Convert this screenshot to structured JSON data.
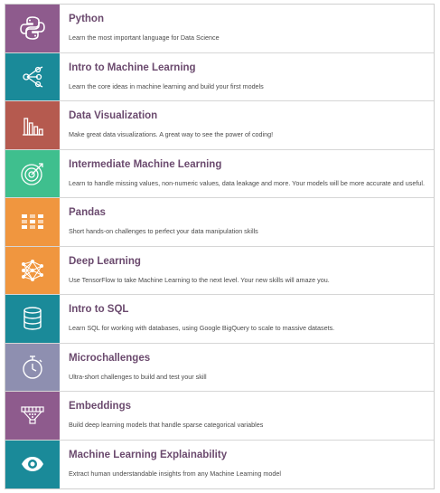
{
  "courses": [
    {
      "title": "Python",
      "description": "Learn the most important language for Data Science",
      "color": "#8e5b8d",
      "icon": "python-logo-icon"
    },
    {
      "title": "Intro to Machine Learning",
      "description": "Learn the core ideas in machine learning and build your first models",
      "color": "#1a8a99",
      "icon": "network-nodes-icon"
    },
    {
      "title": "Data Visualization",
      "description": "Make great data visualizations. A great way to see the power of coding!",
      "color": "#b55a4f",
      "icon": "bar-chart-icon"
    },
    {
      "title": "Intermediate Machine Learning",
      "description": "Learn to handle missing values, non-numeric values, data leakage and more. Your models will be more accurate and useful.",
      "color": "#3fbf8e",
      "icon": "target-icon"
    },
    {
      "title": "Pandas",
      "description": "Short hands-on challenges to perfect your data manipulation skills",
      "color": "#f0963f",
      "icon": "grid-table-icon"
    },
    {
      "title": "Deep Learning",
      "description": "Use TensorFlow to take Machine Learning to the next level. Your new skills will amaze you.",
      "color": "#f0963f",
      "icon": "neural-network-icon"
    },
    {
      "title": "Intro to SQL",
      "description": "Learn SQL for working with databases, using Google BigQuery to scale to massive datasets.",
      "color": "#1a8a99",
      "icon": "database-icon"
    },
    {
      "title": "Microchallenges",
      "description": "Ultra-short challenges to build and test your skill",
      "color": "#8e8fb0",
      "icon": "stopwatch-icon"
    },
    {
      "title": "Embeddings",
      "description": "Build deep learning models that handle sparse categorical variables",
      "color": "#8e5b8d",
      "icon": "embedding-funnel-icon"
    },
    {
      "title": "Machine Learning Explainability",
      "description": "Extract human understandable insights from any Machine Learning model",
      "color": "#1a8a99",
      "icon": "eye-icon"
    }
  ]
}
